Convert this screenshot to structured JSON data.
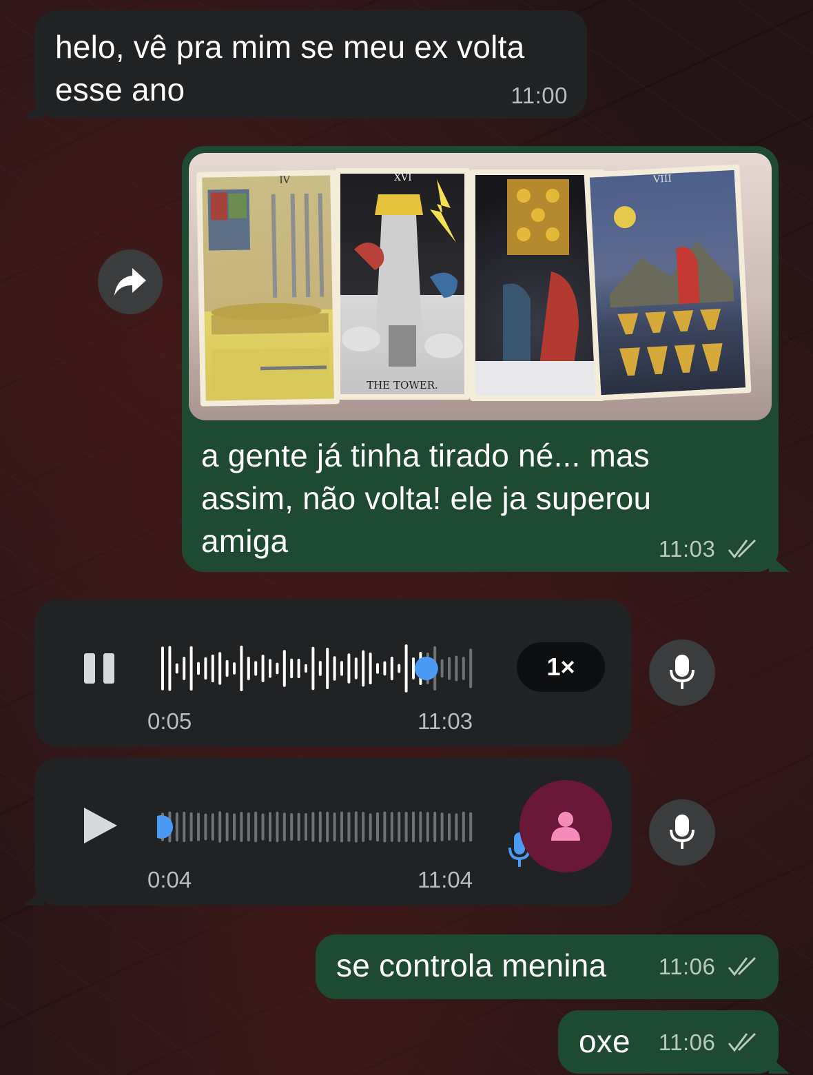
{
  "messages": {
    "m1": {
      "text": "helo, vê pra mim se meu ex volta esse ano",
      "time": "11:00"
    },
    "m2": {
      "caption": "a gente já tinha tirado né... mas assim, não volta! ele ja superou amiga",
      "time": "11:03",
      "photo": {
        "card_numerals": [
          "IV",
          "XVI",
          "",
          "VIII"
        ],
        "card_label": "THE TOWER."
      }
    },
    "voice1": {
      "duration": "0:05",
      "time": "11:03",
      "speed": "1×",
      "state": "playing",
      "progress": 0.84
    },
    "voice2": {
      "duration": "0:04",
      "time": "11:04",
      "state": "paused",
      "progress": 0.0
    },
    "m3": {
      "text": "se controla menina",
      "time": "11:06"
    },
    "m4": {
      "text": "oxe",
      "time": "11:06"
    }
  },
  "icons": {
    "forward": "forward-arrow-icon",
    "pause": "pause-icon",
    "play": "play-icon",
    "mic": "microphone-icon",
    "avatar": "person-icon",
    "ticks": "double-check-icon"
  },
  "colors": {
    "incoming_bubble": "#202223",
    "outgoing_bubble": "#1e4a34",
    "accent_blue": "#4b9bf4",
    "avatar_bg": "#6a1838",
    "avatar_icon": "#f58bb8"
  }
}
